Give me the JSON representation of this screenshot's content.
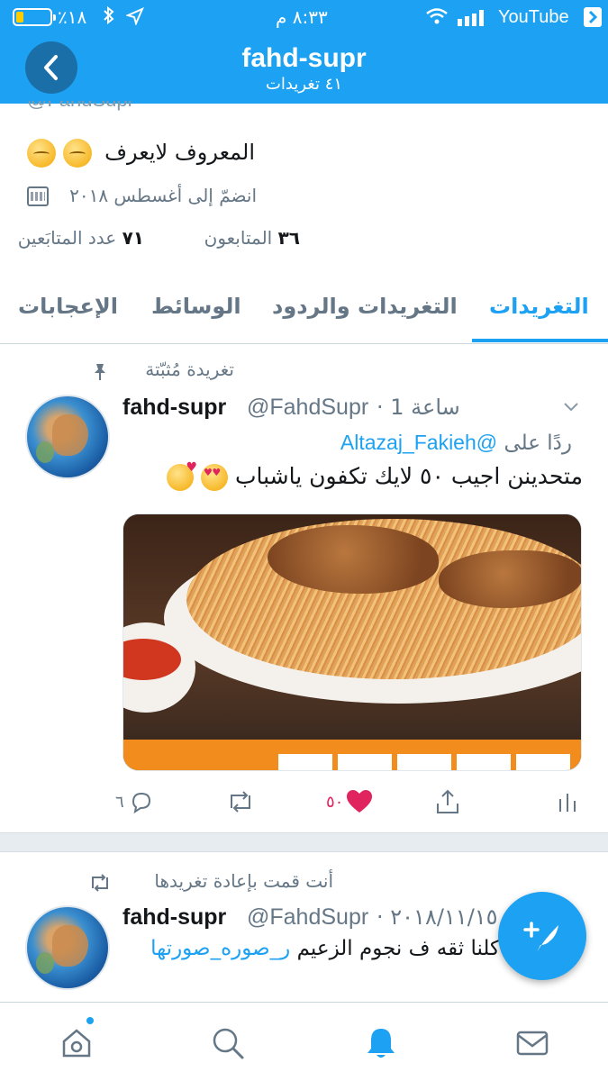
{
  "status_bar": {
    "battery_percent": "٪١٨",
    "time": "٨:٣٣ م",
    "carrier": "YouTube"
  },
  "header": {
    "title": "fahd-supr",
    "subtitle": "٤١ تغريدات"
  },
  "profile": {
    "handle_partial": "@FahdSupr",
    "bio": "المعروف لايعرف",
    "joined": "انضمّ إلى أغسطس ٢٠١٨",
    "following_count": "٣٦",
    "following_label": "المتابعون",
    "followers_count": "٧١",
    "followers_label": "عدد المتابَعين"
  },
  "tabs": [
    {
      "label": "التغريدات",
      "active": true
    },
    {
      "label": "التغريدات والردود",
      "active": false
    },
    {
      "label": "الوسائط",
      "active": false
    },
    {
      "label": "الإعجابات",
      "active": false
    }
  ],
  "tweet1": {
    "context": "تغريدة مُثبّتة",
    "name": "fahd-supr",
    "handle": "@FahdSupr",
    "time": "· 1 ساعة",
    "reply_prefix": "ردًا على",
    "reply_mention": "@Altazaj_Fakieh",
    "text": "متحدينن اجيب ٥٠ لايك تكفون ياشباب",
    "replies": "٦",
    "likes": "٥٠",
    "liked": true
  },
  "tweet2": {
    "context": "أنت قمت بإعادة تغريدها",
    "name": "fahd-supr",
    "handle": "@FahdSupr",
    "time": "· ٢٠١٨/١١/١٥",
    "hashtag": "ر_صوره_صورتها",
    "text": "كلنا ثقه ف نجوم الزعيم"
  },
  "colors": {
    "accent": "#1da1f2",
    "like": "#e0245e",
    "muted": "#657786"
  },
  "icons": {
    "home": "home-icon",
    "search": "search-icon",
    "notifications": "bell-icon",
    "messages": "mail-icon",
    "compose": "compose-tweet-icon"
  }
}
